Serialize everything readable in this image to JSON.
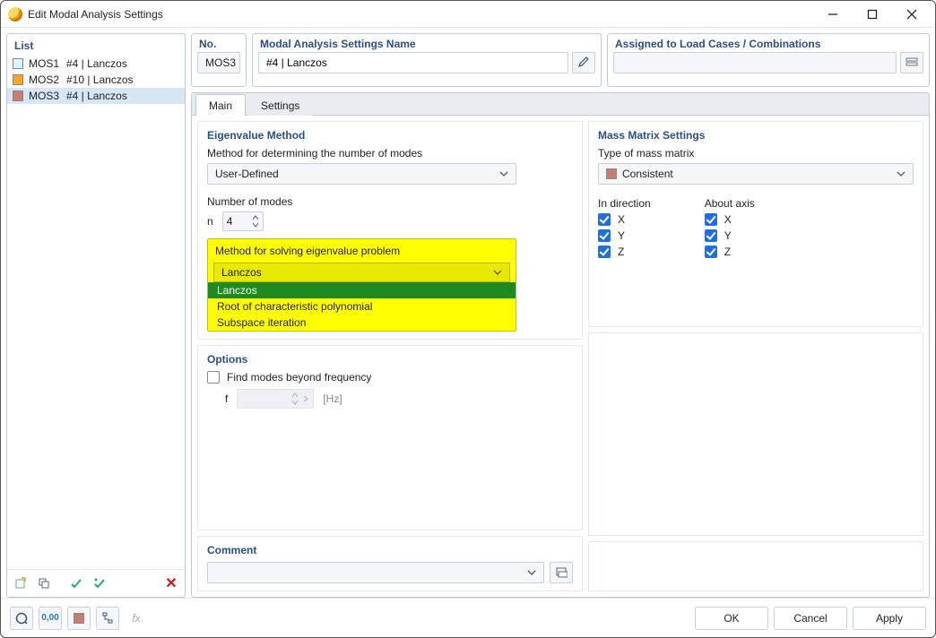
{
  "window": {
    "title": "Edit Modal Analysis Settings"
  },
  "list": {
    "header": "List",
    "items": [
      {
        "code": "MOS1",
        "label": "#4 | Lanczos"
      },
      {
        "code": "MOS2",
        "label": "#10 | Lanczos"
      },
      {
        "code": "MOS3",
        "label": "#4 | Lanczos",
        "selected": true
      }
    ]
  },
  "no": {
    "header": "No.",
    "value": "MOS3"
  },
  "name": {
    "header": "Modal Analysis Settings Name",
    "value": "#4 | Lanczos"
  },
  "assigned": {
    "header": "Assigned to Load Cases / Combinations",
    "value": ""
  },
  "tabs": {
    "main": "Main",
    "settings": "Settings"
  },
  "eigen": {
    "header": "Eigenvalue Method",
    "method_label": "Method for determining the number of modes",
    "method_value": "User-Defined",
    "n_label": "Number of modes",
    "n_sym": "n",
    "n_value": "4",
    "solver_label": "Method for solving eigenvalue problem",
    "solver_value": "Lanczos",
    "solver_options": [
      "Lanczos",
      "Root of characteristic polynomial",
      "Subspace iteration"
    ]
  },
  "options": {
    "header": "Options",
    "beyond_label": "Find modes beyond frequency",
    "f_sym": "f",
    "f_unit": "[Hz]"
  },
  "mass": {
    "header": "Mass Matrix Settings",
    "type_label": "Type of mass matrix",
    "type_value": "Consistent",
    "dir_label": "In direction",
    "axis_label": "About axis",
    "x": "X",
    "y": "Y",
    "z": "Z"
  },
  "comment": {
    "header": "Comment",
    "value": ""
  },
  "buttons": {
    "ok": "OK",
    "cancel": "Cancel",
    "apply": "Apply"
  }
}
